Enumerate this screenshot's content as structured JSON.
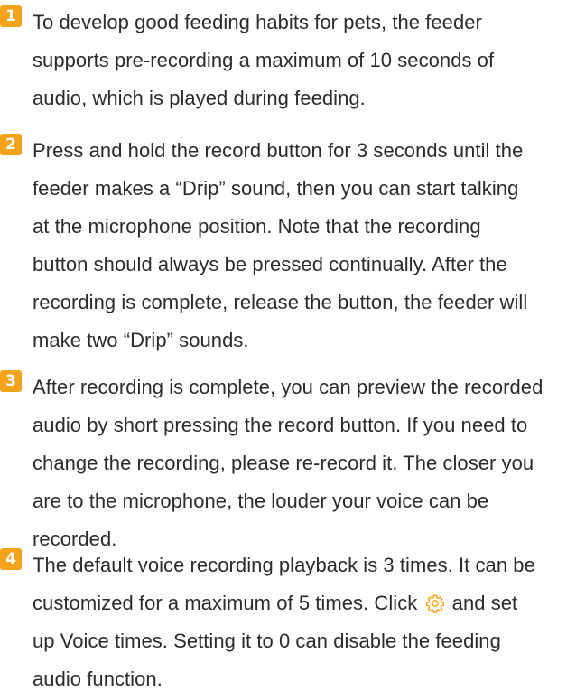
{
  "steps": [
    {
      "number": "1",
      "lines": [
        "To develop good feeding habits for pets, the feeder",
        "supports pre-recording a maximum of 10 seconds of",
        "audio, which is played during feeding."
      ]
    },
    {
      "number": "2",
      "lines": [
        "Press and hold the record button for 3 seconds until the",
        "feeder makes a “Drip” sound, then you can start talking",
        "at the microphone position. Note that the recording",
        "button should always be pressed continually. After the",
        "recording is complete, release the button, the feeder will",
        "make two “Drip” sounds."
      ]
    },
    {
      "number": "3",
      "lines": [
        "After recording is complete, you can preview the recorded",
        "audio by short pressing the record button. If you need to",
        "change the recording, please re-record it. The closer you",
        "are to the microphone, the louder your voice can be",
        "recorded."
      ]
    },
    {
      "number": "4",
      "lines": [
        "The default voice recording playback is 3 times. It can be",
        "customized for a maximum of 5 times. Click",
        "and set",
        "up Voice times. Setting it to 0 can disable the feeding",
        "audio function."
      ]
    }
  ],
  "colors": {
    "badge": "#f5a31a",
    "text": "#2b2b2b",
    "gear_icon": "#f5a31a"
  },
  "icons": {
    "settings": "gear-icon"
  }
}
